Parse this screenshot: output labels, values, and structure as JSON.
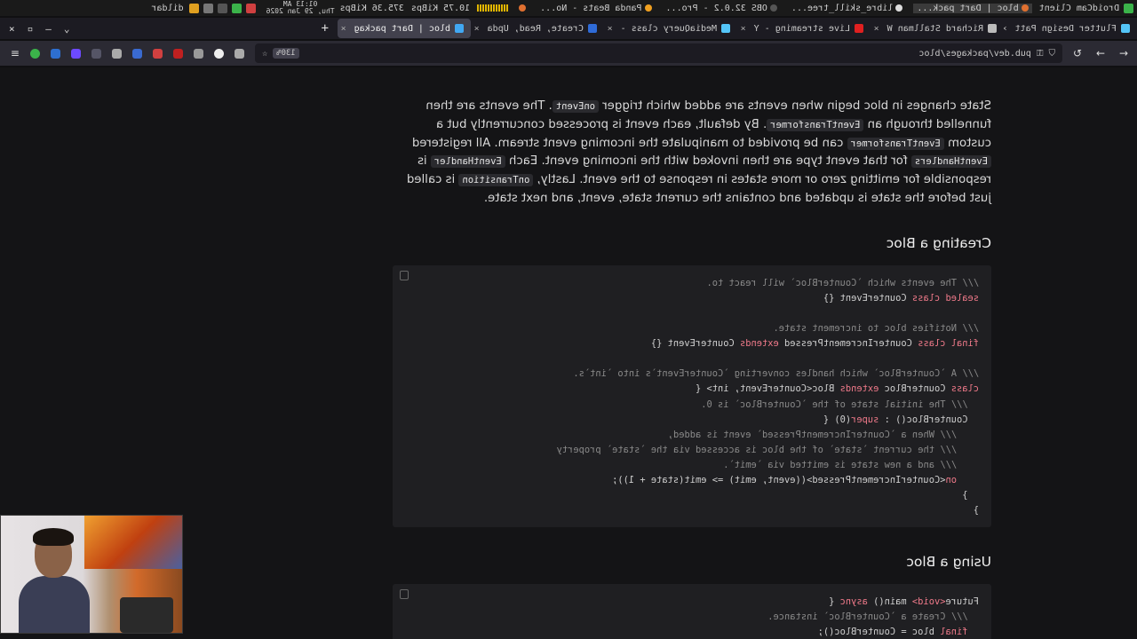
{
  "system_bar": {
    "clock_time": "01:13 AM",
    "clock_date": "Thu, 29 Jan 2026",
    "net_down": "375.36 KiBps",
    "net_up": "10.75 KiBps",
    "user": "dildar",
    "windows": [
      "DroidCam Client",
      "bloc | Dart pack...",
      "libre_skill_tree...",
      "OBS 32.0.2 - Pro...",
      "Panda Beats - No..."
    ]
  },
  "tabs": [
    {
      "label": "bloc | Dart packag",
      "active": true,
      "color": "#41a8f3"
    },
    {
      "label": "Create, Read, Upda",
      "active": false,
      "color": "#2f6bd8"
    },
    {
      "label": "MediaQuery class -",
      "active": false,
      "color": "#54c5f8"
    },
    {
      "label": "Live streaming - Y",
      "active": false,
      "color": "#e02020"
    },
    {
      "label": "Richard Stallman W",
      "active": false,
      "color": "#bbbbbb"
    },
    {
      "label": "Flutter Design Patt",
      "active": false,
      "color": "#54c5f8"
    }
  ],
  "navbar": {
    "url": "pub.dev/packages/bloc",
    "zoom": "130%"
  },
  "content": {
    "intro_parts": [
      "State changes in bloc begin when events are added which trigger ",
      "onEvent",
      ". The events are then funnelled through an ",
      "EventTransformer",
      ". By default, each event is processed concurrently but a custom ",
      "EventTransformer",
      " can be provided to manipulate the incoming event stream. All registered ",
      "EventHandlers",
      " for that event type are then invoked with the incoming event. Each ",
      "EventHandler",
      " is responsible for emitting zero or more states in response to the event. Lastly, ",
      "onTransition",
      " is called just before the state is updated and contains the current state, event, and next state."
    ],
    "heading_creating": "Creating a Bloc",
    "code_creating": [
      [
        {
          "t": "/// The events which `CounterBloc` will react to.",
          "c": "cm"
        }
      ],
      [
        {
          "t": "sealed class",
          "c": "kw"
        },
        {
          "t": " CounterEvent {}",
          "c": ""
        }
      ],
      [],
      [
        {
          "t": "/// Notifies bloc to increment state.",
          "c": "cm"
        }
      ],
      [
        {
          "t": "final class",
          "c": "kw"
        },
        {
          "t": " CounterIncrementPressed ",
          "c": ""
        },
        {
          "t": "extends",
          "c": "kw"
        },
        {
          "t": " CounterEvent {}",
          "c": ""
        }
      ],
      [],
      [
        {
          "t": "/// A `CounterBloc` which handles converting `CounterEvent`s into `int`s.",
          "c": "cm"
        }
      ],
      [
        {
          "t": "class",
          "c": "kw"
        },
        {
          "t": " CounterBloc ",
          "c": ""
        },
        {
          "t": "extends",
          "c": "kw"
        },
        {
          "t": " Bloc<CounterEvent, int> {",
          "c": ""
        }
      ],
      [
        {
          "t": "  /// The initial state of the `CounterBloc` is 0.",
          "c": "cm"
        }
      ],
      [
        {
          "t": "  CounterBloc() : ",
          "c": ""
        },
        {
          "t": "super",
          "c": "kw"
        },
        {
          "t": "(0) {",
          "c": ""
        }
      ],
      [
        {
          "t": "    /// When a `CounterIncrementPressed` event is added,",
          "c": "cm"
        }
      ],
      [
        {
          "t": "    /// the current `state` of the bloc is accessed via the `state` property",
          "c": "cm"
        }
      ],
      [
        {
          "t": "    /// and a new state is emitted via `emit`.",
          "c": "cm"
        }
      ],
      [
        {
          "t": "    on",
          "c": "kw"
        },
        {
          "t": "<CounterIncrementPressed>((event, emit) => emit(state + 1));",
          "c": ""
        }
      ],
      [
        {
          "t": "  }",
          "c": ""
        }
      ],
      [
        {
          "t": "}",
          "c": ""
        }
      ]
    ],
    "heading_using": "Using a Bloc",
    "code_using": [
      [
        {
          "t": "Future",
          "c": ""
        },
        {
          "t": "<void>",
          "c": "kw"
        },
        {
          "t": " main() ",
          "c": ""
        },
        {
          "t": "async",
          "c": "kw"
        },
        {
          "t": " {",
          "c": ""
        }
      ],
      [
        {
          "t": "  /// Create a `CounterBloc` instance.",
          "c": "cm"
        }
      ],
      [
        {
          "t": "  final",
          "c": "kw"
        },
        {
          "t": " bloc = CounterBloc();",
          "c": ""
        }
      ]
    ]
  }
}
